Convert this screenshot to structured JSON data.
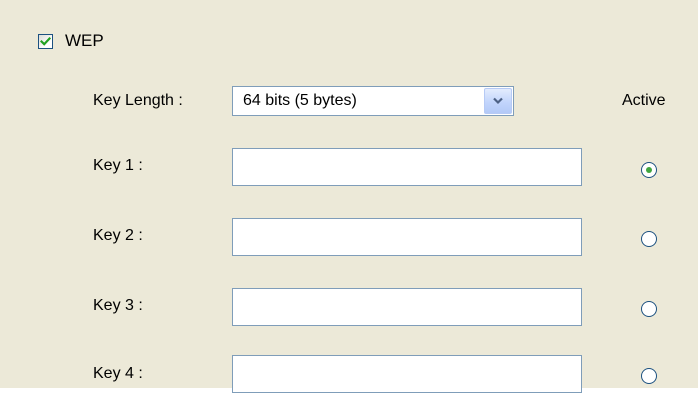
{
  "wep": {
    "label": "WEP",
    "checked": true
  },
  "key_length": {
    "label": "Key Length :",
    "selected": "64 bits (5 bytes)"
  },
  "active_label": "Active",
  "keys": [
    {
      "label": "Key 1 :",
      "value": "",
      "active": true
    },
    {
      "label": "Key 2 :",
      "value": "",
      "active": false
    },
    {
      "label": "Key 3 :",
      "value": "",
      "active": false
    },
    {
      "label": "Key 4 :",
      "value": "",
      "active": false
    }
  ],
  "icons": {
    "checkbox": "checkmark-icon",
    "dropdown": "chevron-down-icon",
    "radio": "radio-button"
  },
  "colors": {
    "panel_bg": "#ECE9D8",
    "input_border": "#7F9DB9",
    "check_green": "#21A121",
    "radio_dot_green": "#3FA53F",
    "dropdown_arrow": "#4D6185"
  }
}
